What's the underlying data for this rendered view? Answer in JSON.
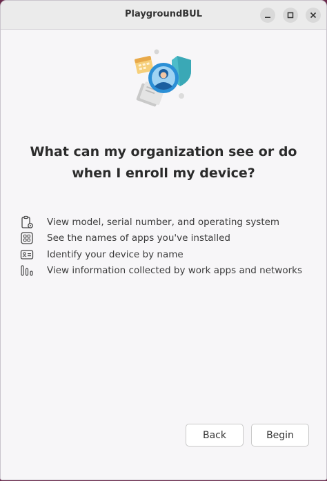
{
  "window": {
    "title": "PlaygroundBUL",
    "controls": {
      "minimize": "minimize-icon",
      "maximize": "maximize-icon",
      "close": "close-icon"
    }
  },
  "main": {
    "heading_line1": "What can my organization see or do",
    "heading_line2": "when I enroll my device?",
    "items": [
      {
        "icon": "clipboard-gear-icon",
        "label": "View model, serial number, and operating system"
      },
      {
        "icon": "apps-grid-icon",
        "label": "See the names of apps you've installed"
      },
      {
        "icon": "id-card-icon",
        "label": "Identify your device by name"
      },
      {
        "icon": "network-bars-icon",
        "label": "View information collected by work apps and networks"
      }
    ]
  },
  "footer": {
    "back_label": "Back",
    "begin_label": "Begin"
  },
  "colors": {
    "desktop": "#6b2a4c",
    "window_bg": "#f7f6f8",
    "accent_blue": "#2b8fd6"
  }
}
